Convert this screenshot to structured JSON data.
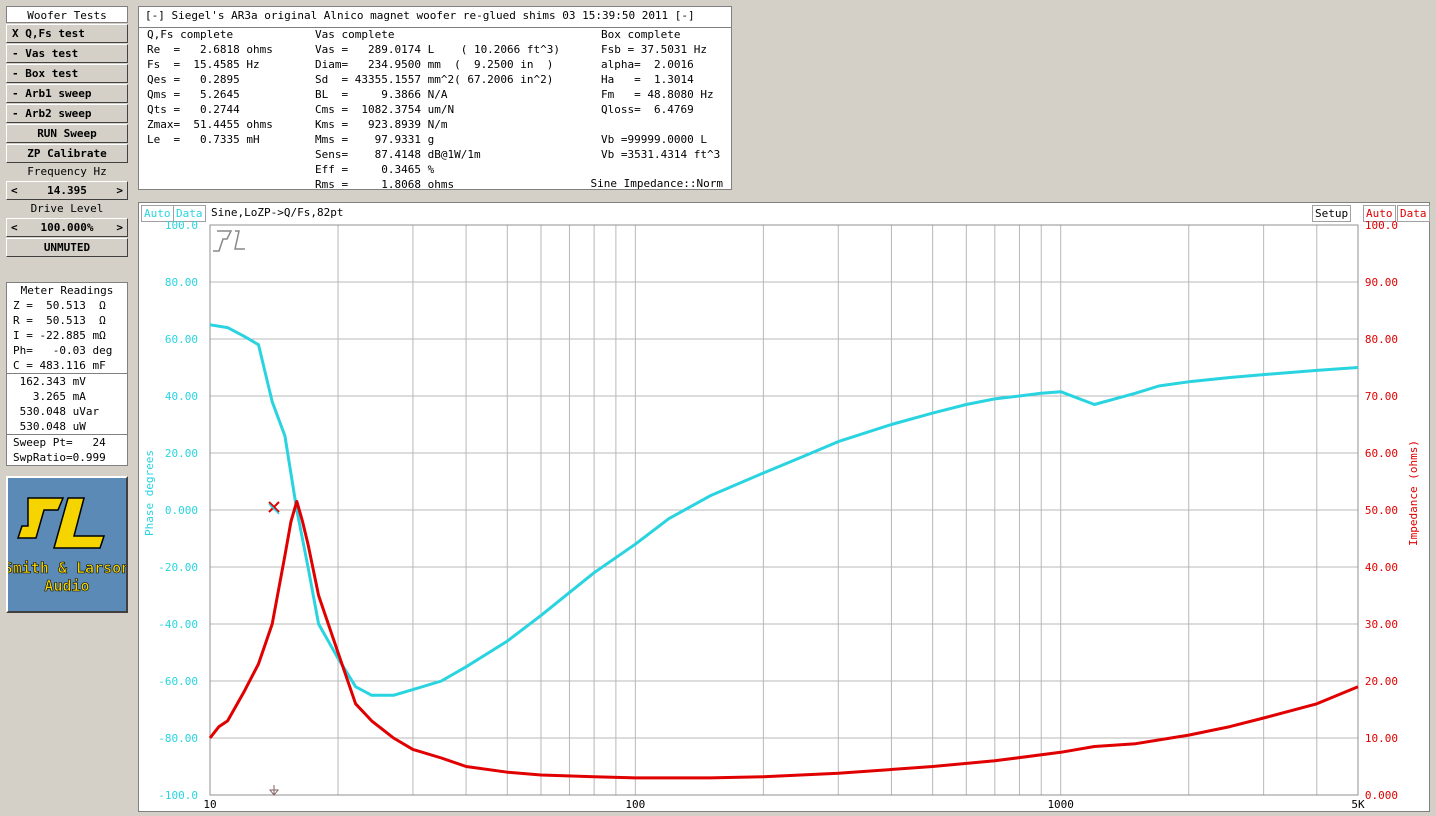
{
  "left": {
    "title": "Woofer Tests",
    "buttons": [
      "X Q,Fs test",
      "- Vas test",
      "- Box test",
      "- Arb1 sweep",
      "- Arb2 sweep"
    ],
    "run_sweep": "RUN Sweep",
    "zp_calibrate": "ZP Calibrate",
    "freq_label": "Frequency Hz",
    "freq_left": "<",
    "freq_value": "14.395",
    "freq_right": ">",
    "drive_label": "Drive Level",
    "drive_left": "<",
    "drive_value": "100.000%",
    "drive_right": ">",
    "mute": "UNMUTED"
  },
  "meter": {
    "title": "Meter Readings",
    "rows1": [
      "Z =  50.513  Ω",
      "R =  50.513  Ω",
      "I = -22.885 mΩ",
      "Ph=   -0.03 deg",
      "C = 483.116 mF"
    ],
    "rows2": [
      " 162.343 mV",
      "   3.265 mA",
      " 530.048 uVar",
      " 530.048 uW"
    ],
    "rows3": [
      "Sweep Pt=   24",
      "SwpRatio=0.999"
    ]
  },
  "logo": {
    "line1": "Smith & Larson",
    "line2": "Audio"
  },
  "info": {
    "title": "[-] Siegel's AR3a original Alnico magnet woofer re-glued shims 03 15:39:50 2011 [-]",
    "qfs_header": "Q,Fs complete",
    "qfs": [
      "Re  =   2.6818 ohms",
      "Fs  =  15.4585 Hz",
      "Qes =   0.2895",
      "Qms =   5.2645",
      "Qts =   0.2744",
      "Zmax=  51.4455 ohms",
      "Le  =   0.7335 mH"
    ],
    "vas_header": "Vas complete",
    "vas": [
      "Vas =   289.0174 L    ( 10.2066 ft^3)",
      "Diam=   234.9500 mm  (  9.2500 in  )",
      "Sd  = 43355.1557 mm^2( 67.2006 in^2)",
      "BL  =     9.3866 N/A",
      "Cms =  1082.3754 um/N",
      "Kms =   923.8939 N/m",
      "Mms =    97.9331 g",
      "Sens=    87.4148 dB@1W/1m",
      "Eff =     0.3465 %",
      "Rms =     1.8068 ohms"
    ],
    "box_header": "Box complete",
    "box": [
      "Fsb = 37.5031 Hz",
      "alpha=  2.0016",
      "Ha   =  1.3014",
      "Fm   = 48.8080 Hz",
      "Qloss=  6.4769",
      "",
      "Vb =99999.0000 L",
      "Vb =3531.4314 ft^3"
    ],
    "footer": "Sine Impedance::Norm"
  },
  "chart_header": {
    "auto_left": "Auto",
    "data_left": "Data",
    "desc": "Sine,LoZP->Q/Fs,82pt",
    "setup": "Setup",
    "auto_right": "Auto",
    "data_right": "Data"
  },
  "colors": {
    "phase": "#29d4e0",
    "impedance": "#e00000",
    "grid": "#b8b8b8"
  },
  "chart_data": {
    "type": "line",
    "x_scale": "log",
    "xlim": [
      10,
      5000
    ],
    "x_ticks": [
      {
        "v": 10,
        "l": "10"
      },
      {
        "v": 100,
        "l": "100"
      },
      {
        "v": 1000,
        "l": "1000"
      },
      {
        "v": 5000,
        "l": "5K"
      }
    ],
    "y_left": {
      "label": "Phase degrees",
      "lim": [
        -100,
        100
      ],
      "ticks": [
        "100.0",
        "80.00",
        "60.00",
        "40.00",
        "20.00",
        "0.000",
        "-20.00",
        "-40.00",
        "-60.00",
        "-80.00",
        "-100.0"
      ]
    },
    "y_right": {
      "label": "Impedance (ohms)",
      "lim": [
        0,
        100
      ],
      "ticks": [
        "100.0",
        "90.00",
        "80.00",
        "70.00",
        "60.00",
        "50.00",
        "40.00",
        "30.00",
        "20.00",
        "10.00",
        "0.000"
      ]
    },
    "series": [
      {
        "name": "Phase degrees",
        "axis": "left",
        "points": [
          [
            10,
            65
          ],
          [
            11,
            64
          ],
          [
            12,
            61
          ],
          [
            13,
            58
          ],
          [
            14,
            38
          ],
          [
            15,
            26
          ],
          [
            16,
            0
          ],
          [
            17,
            -20
          ],
          [
            18,
            -40
          ],
          [
            20,
            -52
          ],
          [
            22,
            -62
          ],
          [
            24,
            -65
          ],
          [
            27,
            -65
          ],
          [
            30,
            -63
          ],
          [
            35,
            -60
          ],
          [
            40,
            -55
          ],
          [
            50,
            -46
          ],
          [
            60,
            -37
          ],
          [
            80,
            -22
          ],
          [
            100,
            -12
          ],
          [
            120,
            -3
          ],
          [
            150,
            5
          ],
          [
            200,
            13
          ],
          [
            250,
            19
          ],
          [
            300,
            24
          ],
          [
            400,
            30
          ],
          [
            500,
            34
          ],
          [
            600,
            37
          ],
          [
            700,
            39
          ],
          [
            800,
            40
          ],
          [
            900,
            41
          ],
          [
            1000,
            41.5
          ],
          [
            1200,
            37
          ],
          [
            1500,
            41
          ],
          [
            1700,
            43.5
          ],
          [
            2000,
            45
          ],
          [
            2500,
            46.5
          ],
          [
            3000,
            47.5
          ],
          [
            4000,
            49
          ],
          [
            5000,
            50
          ]
        ]
      },
      {
        "name": "Impedance (ohms)",
        "axis": "right",
        "points": [
          [
            10,
            10
          ],
          [
            10.5,
            12
          ],
          [
            11,
            13
          ],
          [
            12,
            18
          ],
          [
            13,
            23
          ],
          [
            14,
            30
          ],
          [
            15,
            42
          ],
          [
            15.5,
            48
          ],
          [
            16,
            51.5
          ],
          [
            16.5,
            48
          ],
          [
            17,
            44
          ],
          [
            18,
            35
          ],
          [
            20,
            25
          ],
          [
            22,
            16
          ],
          [
            24,
            13
          ],
          [
            27,
            10
          ],
          [
            30,
            8
          ],
          [
            35,
            6.5
          ],
          [
            40,
            5
          ],
          [
            50,
            4
          ],
          [
            60,
            3.5
          ],
          [
            80,
            3.2
          ],
          [
            100,
            3
          ],
          [
            150,
            3
          ],
          [
            200,
            3.2
          ],
          [
            300,
            3.8
          ],
          [
            500,
            5
          ],
          [
            700,
            6
          ],
          [
            1000,
            7.5
          ],
          [
            1200,
            8.5
          ],
          [
            1500,
            9
          ],
          [
            2000,
            10.5
          ],
          [
            2500,
            12
          ],
          [
            3000,
            13.5
          ],
          [
            4000,
            16
          ],
          [
            5000,
            19
          ]
        ]
      }
    ]
  }
}
